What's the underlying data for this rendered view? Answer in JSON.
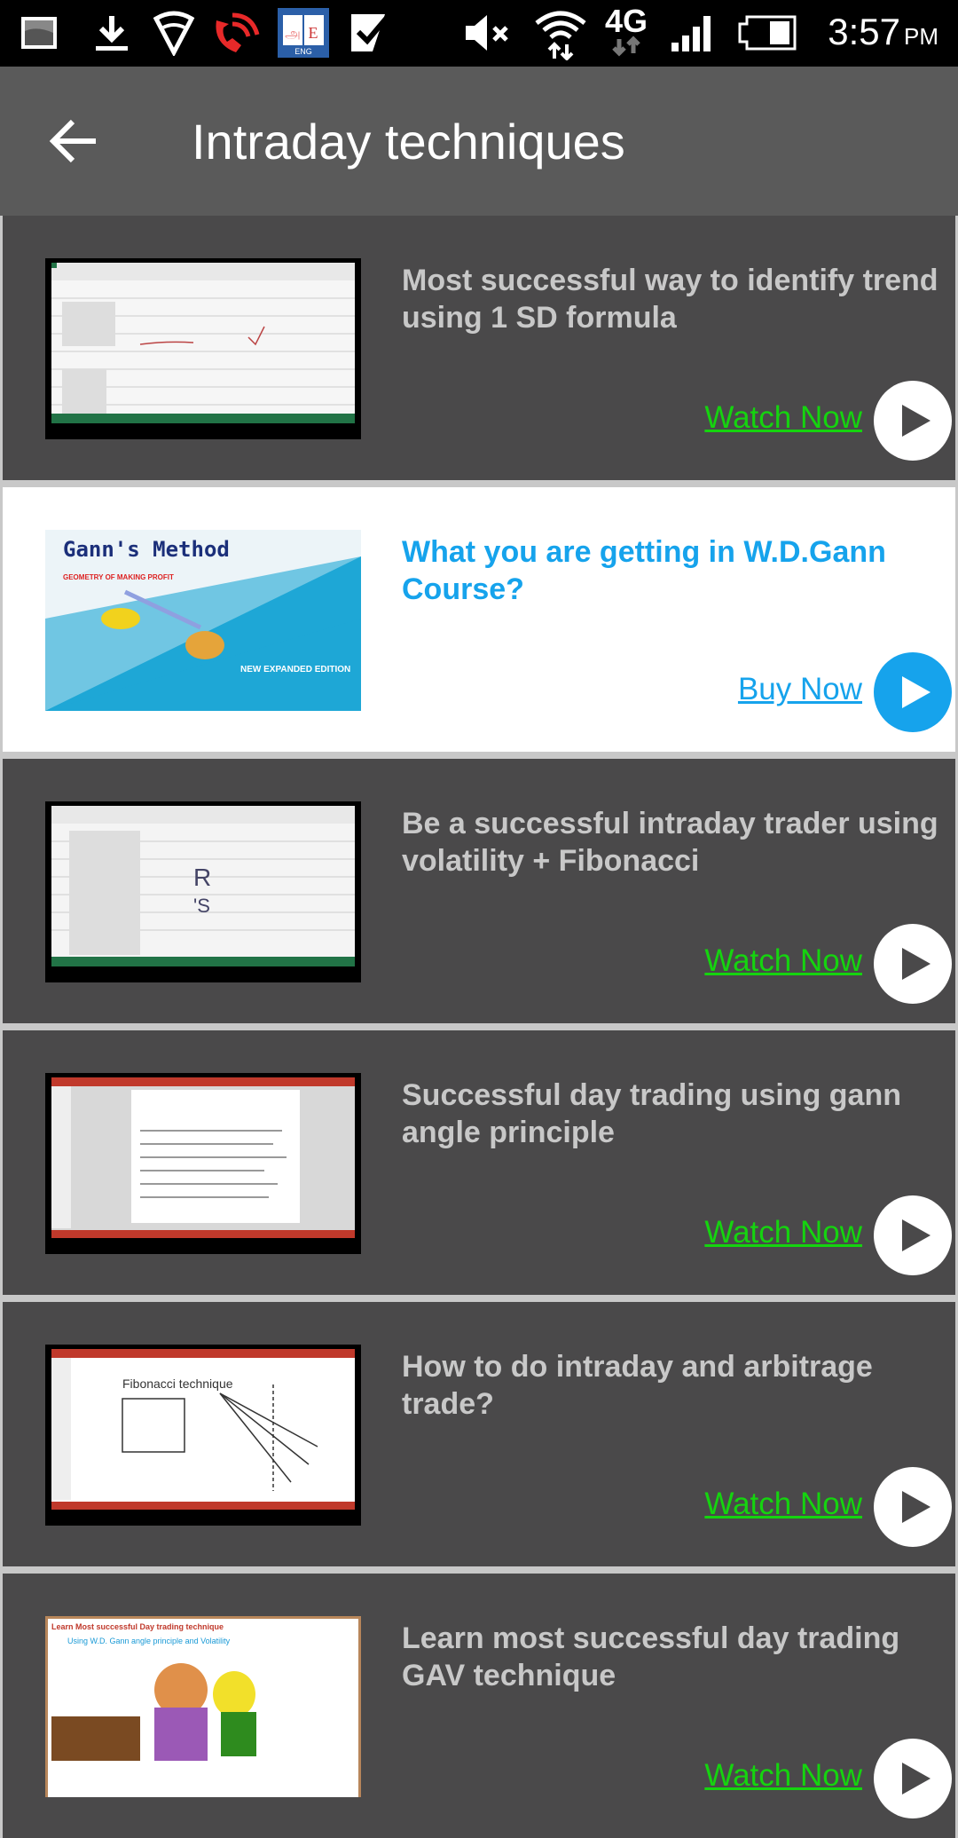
{
  "status_bar": {
    "time": "3:57",
    "ampm": "PM",
    "network": "4G",
    "left_icons": [
      "gallery-icon",
      "download-icon",
      "vpn-shield-icon",
      "missed-wifi-call-icon",
      "dictionary-app-icon",
      "checkmark-app-icon"
    ],
    "right_icons": [
      "mute-icon",
      "wifi-icon",
      "4g-icon",
      "signal-icon",
      "battery-icon"
    ]
  },
  "app_bar": {
    "title": "Intraday techniques",
    "back_icon": "arrow-left-icon"
  },
  "colors": {
    "card_dark": "#4a494a",
    "accent_blue": "#16a3ec",
    "watch_green": "#15d40f",
    "app_bar": "#5a5a5a"
  },
  "items": [
    {
      "title": "Most successful way to identify trend using 1 SD formula",
      "cta": "Watch Now",
      "style": "dark",
      "thumb": "spreadsheet-video"
    },
    {
      "title": "What you are getting in W.D.Gann Course?",
      "cta": "Buy Now",
      "style": "light",
      "thumb": "book-cover"
    },
    {
      "title": "Be a successful intraday trader using volatility + Fibonacci",
      "cta": "Watch Now",
      "style": "dark",
      "thumb": "spreadsheet-video"
    },
    {
      "title": "Successful day trading using gann angle principle",
      "cta": "Watch Now",
      "style": "dark",
      "thumb": "document-video"
    },
    {
      "title": "How to do intraday and arbitrage trade?",
      "cta": "Watch Now",
      "style": "dark",
      "thumb": "slides-video"
    },
    {
      "title": "Learn most successful day trading GAV technique",
      "cta": "Watch Now",
      "style": "dark",
      "thumb": "illustration"
    }
  ],
  "thumb_texts": {
    "book_title": "Gann's Method",
    "book_subtitle": "GEOMETRY OF MAKING PROFIT",
    "book_edition": "NEW EXPANDED EDITION",
    "item6_heading": "Learn Most successful Day trading technique",
    "item6_sub": "Using W.D. Gann angle principle and Volatility",
    "item5_heading": "Fibonacci technique"
  }
}
